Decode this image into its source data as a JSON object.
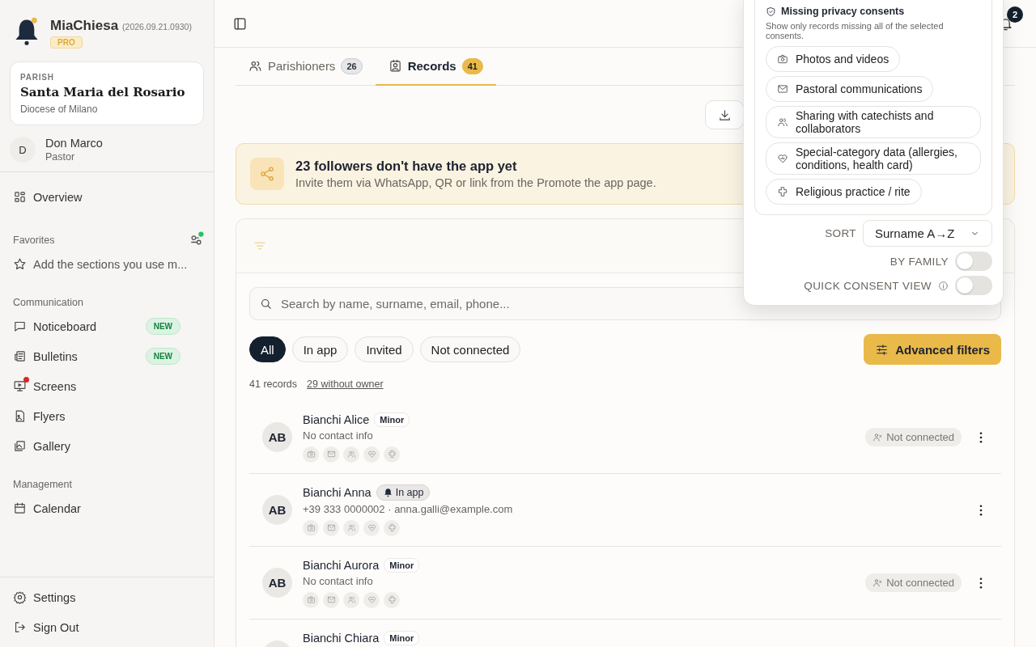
{
  "sidebar": {
    "brand": {
      "name": "MiaChiesa",
      "version": "(2026.09.21.0930)",
      "plan": "PRO"
    },
    "parish": {
      "label": "PARISH",
      "name": "Santa Maria del Rosario",
      "diocese": "Diocese of Milano"
    },
    "user": {
      "initial": "D",
      "name": "Don Marco",
      "role": "Pastor"
    },
    "top_items": [
      {
        "label": "Overview"
      }
    ],
    "favorites": {
      "title": "Favorites",
      "hint": "Add the sections you use m..."
    },
    "sections": [
      {
        "title": "Communication",
        "items": [
          {
            "label": "Noticeboard",
            "badge": "NEW",
            "dot": false
          },
          {
            "label": "Bulletins",
            "badge": "NEW",
            "dot": false
          },
          {
            "label": "Screens",
            "dot": true
          },
          {
            "label": "Flyers",
            "dot": false
          },
          {
            "label": "Gallery",
            "dot": false
          }
        ]
      },
      {
        "title": "Management",
        "items": [
          {
            "label": "Calendar",
            "dot": false
          }
        ]
      }
    ],
    "footer_items": [
      {
        "label": "Settings"
      },
      {
        "label": "Sign Out"
      }
    ]
  },
  "header": {
    "notifications": "2"
  },
  "tabs": [
    {
      "label": "Parishioners",
      "count": "26",
      "selected": false
    },
    {
      "label": "Records",
      "count": "41",
      "selected": true
    }
  ],
  "banner": {
    "title": "23 followers don't have the app yet",
    "text": "Invite them via WhatsApp, QR or link from the Promote the app page."
  },
  "search": {
    "placeholder": "Search by name, surname, email, phone..."
  },
  "filters": [
    {
      "label": "All",
      "selected": true
    },
    {
      "label": "In app",
      "selected": false
    },
    {
      "label": "Invited",
      "selected": false
    },
    {
      "label": "Not connected",
      "selected": false
    }
  ],
  "advanced_button": "Advanced filters",
  "counts": {
    "records": "41 records",
    "without_owner": "29 without owner"
  },
  "rows": [
    {
      "initials": "AB",
      "name": "Bianchi Alice",
      "tag": {
        "kind": "minor",
        "label": "Minor"
      },
      "contact": "No contact info",
      "status": "Not connected"
    },
    {
      "initials": "AB",
      "name": "Bianchi Anna",
      "tag": {
        "kind": "app",
        "label": "In app"
      },
      "contact": "+39 333 0000002 · anna.galli@example.com"
    },
    {
      "initials": "AB",
      "name": "Bianchi Aurora",
      "tag": {
        "kind": "minor",
        "label": "Minor"
      },
      "contact": "No contact info",
      "status": "Not connected"
    },
    {
      "name": "Bianchi Chiara",
      "tag": {
        "kind": "minor",
        "label": "Minor"
      }
    }
  ],
  "popup": {
    "consents": {
      "title": "Missing privacy consents",
      "hint": "Show only records missing all of the selected consents.",
      "options": [
        "Photos and videos",
        "Pastoral communications",
        "Sharing with catechists and collaborators",
        "Special-category data (allergies, conditions, health card)",
        "Religious practice / rite"
      ]
    },
    "sort": {
      "label": "SORT",
      "value": "Surname A→Z"
    },
    "toggles": [
      {
        "label": "BY FAMILY",
        "on": false
      },
      {
        "label": "QUICK CONSENT VIEW",
        "on": false,
        "info": true
      }
    ]
  }
}
